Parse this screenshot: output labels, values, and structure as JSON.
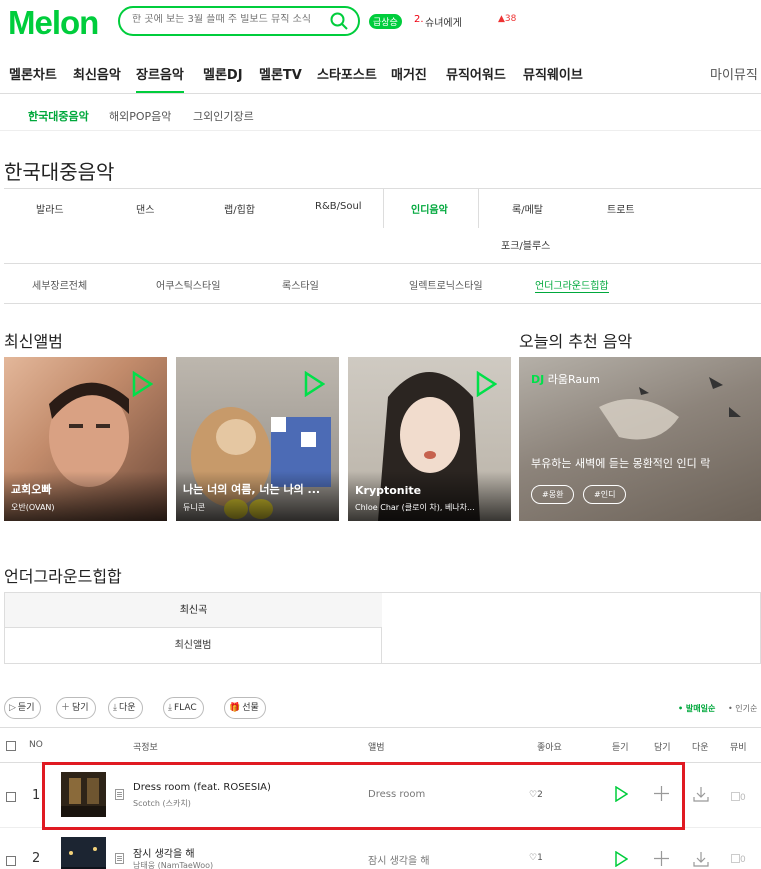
{
  "header": {
    "logo": "Melon",
    "search_placeholder": "한 곳에 보는 3월 플때 주 빌보드 뮤직 소식",
    "rank_badge": "급상승",
    "rank_num": "2.",
    "rank_title": "슈녀에게",
    "rank_change": "38",
    "accent": "#00cd3c"
  },
  "gnb": {
    "items": [
      "멜론차트",
      "최신음악",
      "장르음악",
      "멜론DJ",
      "멜론TV",
      "스타포스트",
      "매거진",
      "뮤직어워드",
      "뮤직웨이브"
    ],
    "active_index": 2,
    "mymusic": "마이뮤직"
  },
  "subnav": {
    "items": [
      "한국대중음악",
      "해외POP음악",
      "그외인기장르"
    ],
    "active_index": 0
  },
  "page_title": "한국대중음악",
  "genres": {
    "row1": [
      "발라드",
      "댄스",
      "랩/힙합",
      "R&B/Soul",
      "인디음악",
      "록/메탈",
      "트로트"
    ],
    "row2": [
      "포크/블루스"
    ],
    "active": "인디음악"
  },
  "sub_genres": {
    "items": [
      "세부장르전체",
      "어쿠스틱스타일",
      "록스타일",
      "일렉트로닉스타일",
      "언더그라운드힙합"
    ],
    "active_index": 4
  },
  "latest_albums": {
    "title": "최신앨범",
    "cards": [
      {
        "title": "교회오빠",
        "artist": "오반(OVAN)"
      },
      {
        "title": "나는 너의 여름, 너는 나의 ...",
        "artist": "듀니콘"
      },
      {
        "title": "Kryptonite",
        "artist": "Chloe Char (클로이 차), 베나차..."
      }
    ]
  },
  "recommend": {
    "title": "오늘의 추천 음악",
    "dj_prefix": "DJ",
    "dj_name": "라움Raum",
    "desc": "부유하는 새벽에 듣는 몽환적인 인디 락",
    "tags": [
      "#몽환",
      "#인디"
    ]
  },
  "section_title": "언더그라운드힙합",
  "tabs": [
    "최신곡",
    "최신앨범"
  ],
  "actions": [
    "듣기",
    "담기",
    "다운",
    "FLAC",
    "선물"
  ],
  "sort": {
    "active": "발매일순",
    "other": "인기순"
  },
  "table": {
    "headers": {
      "no": "NO",
      "song": "곡정보",
      "album": "앨범",
      "like": "좋아요",
      "listen": "듣기",
      "add": "담기",
      "down": "다운",
      "mv": "뮤비"
    },
    "rows": [
      {
        "no": "1",
        "title": "Dress room (feat. ROSESIA)",
        "artist": "Scotch (스카치)",
        "album": "Dress room",
        "likes": "2",
        "mv": "0"
      },
      {
        "no": "2",
        "title": "잠시 생각을 해",
        "artist": "남태웅 (NamTaeWoo)",
        "album": "잠시 생각을 해",
        "likes": "1",
        "mv": "0"
      }
    ]
  }
}
